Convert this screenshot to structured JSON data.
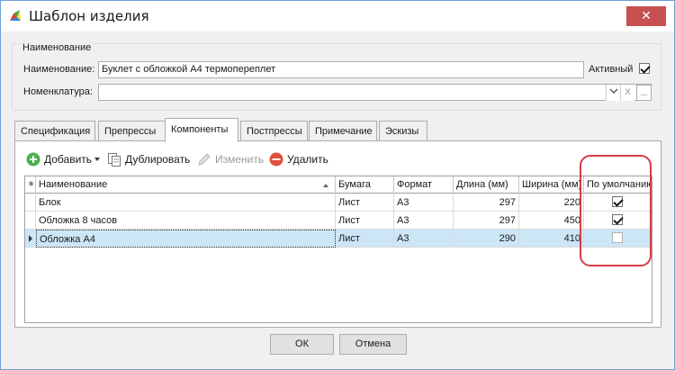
{
  "window": {
    "title": "Шаблон изделия",
    "close_glyph": "✕"
  },
  "group": {
    "legend": "Наименование",
    "name_label": "Наименование:",
    "name_value": "Буклет с обложкой А4 термопереплет",
    "active_label": "Активный",
    "active_checked": true,
    "nomenclature_label": "Номенклатура:",
    "nomenclature_value": "",
    "clear_glyph": "X",
    "more_glyph": "..."
  },
  "tabs": [
    {
      "label": "Спецификация",
      "active": false
    },
    {
      "label": "Препрессы",
      "active": false
    },
    {
      "label": "Компоненты",
      "active": true
    },
    {
      "label": "Постпрессы",
      "active": false
    },
    {
      "label": "Примечание",
      "active": false
    },
    {
      "label": "Эскизы",
      "active": false
    }
  ],
  "toolbar": {
    "add_label": "Добавить",
    "duplicate_label": "Дублировать",
    "edit_label": "Изменить",
    "delete_label": "Удалить"
  },
  "grid": {
    "columns": [
      "Наименование",
      "Бумага",
      "Формат",
      "Длина (мм)",
      "Ширина (мм)",
      "По умолчанию"
    ],
    "rows": [
      {
        "name": "Блок",
        "paper": "Лист",
        "format": "А3",
        "length": "297",
        "width": "220",
        "default": true
      },
      {
        "name": "Обложка 8 часов",
        "paper": "Лист",
        "format": "А3",
        "length": "297",
        "width": "450",
        "default": true
      },
      {
        "name": "Обложка А4",
        "paper": "Лист",
        "format": "А3",
        "length": "290",
        "width": "410",
        "default": false
      }
    ]
  },
  "buttons": {
    "ok": "ОК",
    "cancel": "Отмена"
  },
  "colors": {
    "annotation": "#d73a49",
    "selected_row": "#cde6f7",
    "add_icon": "#4caf50",
    "delete_icon": "#e0503c",
    "close_btn": "#c75050"
  }
}
